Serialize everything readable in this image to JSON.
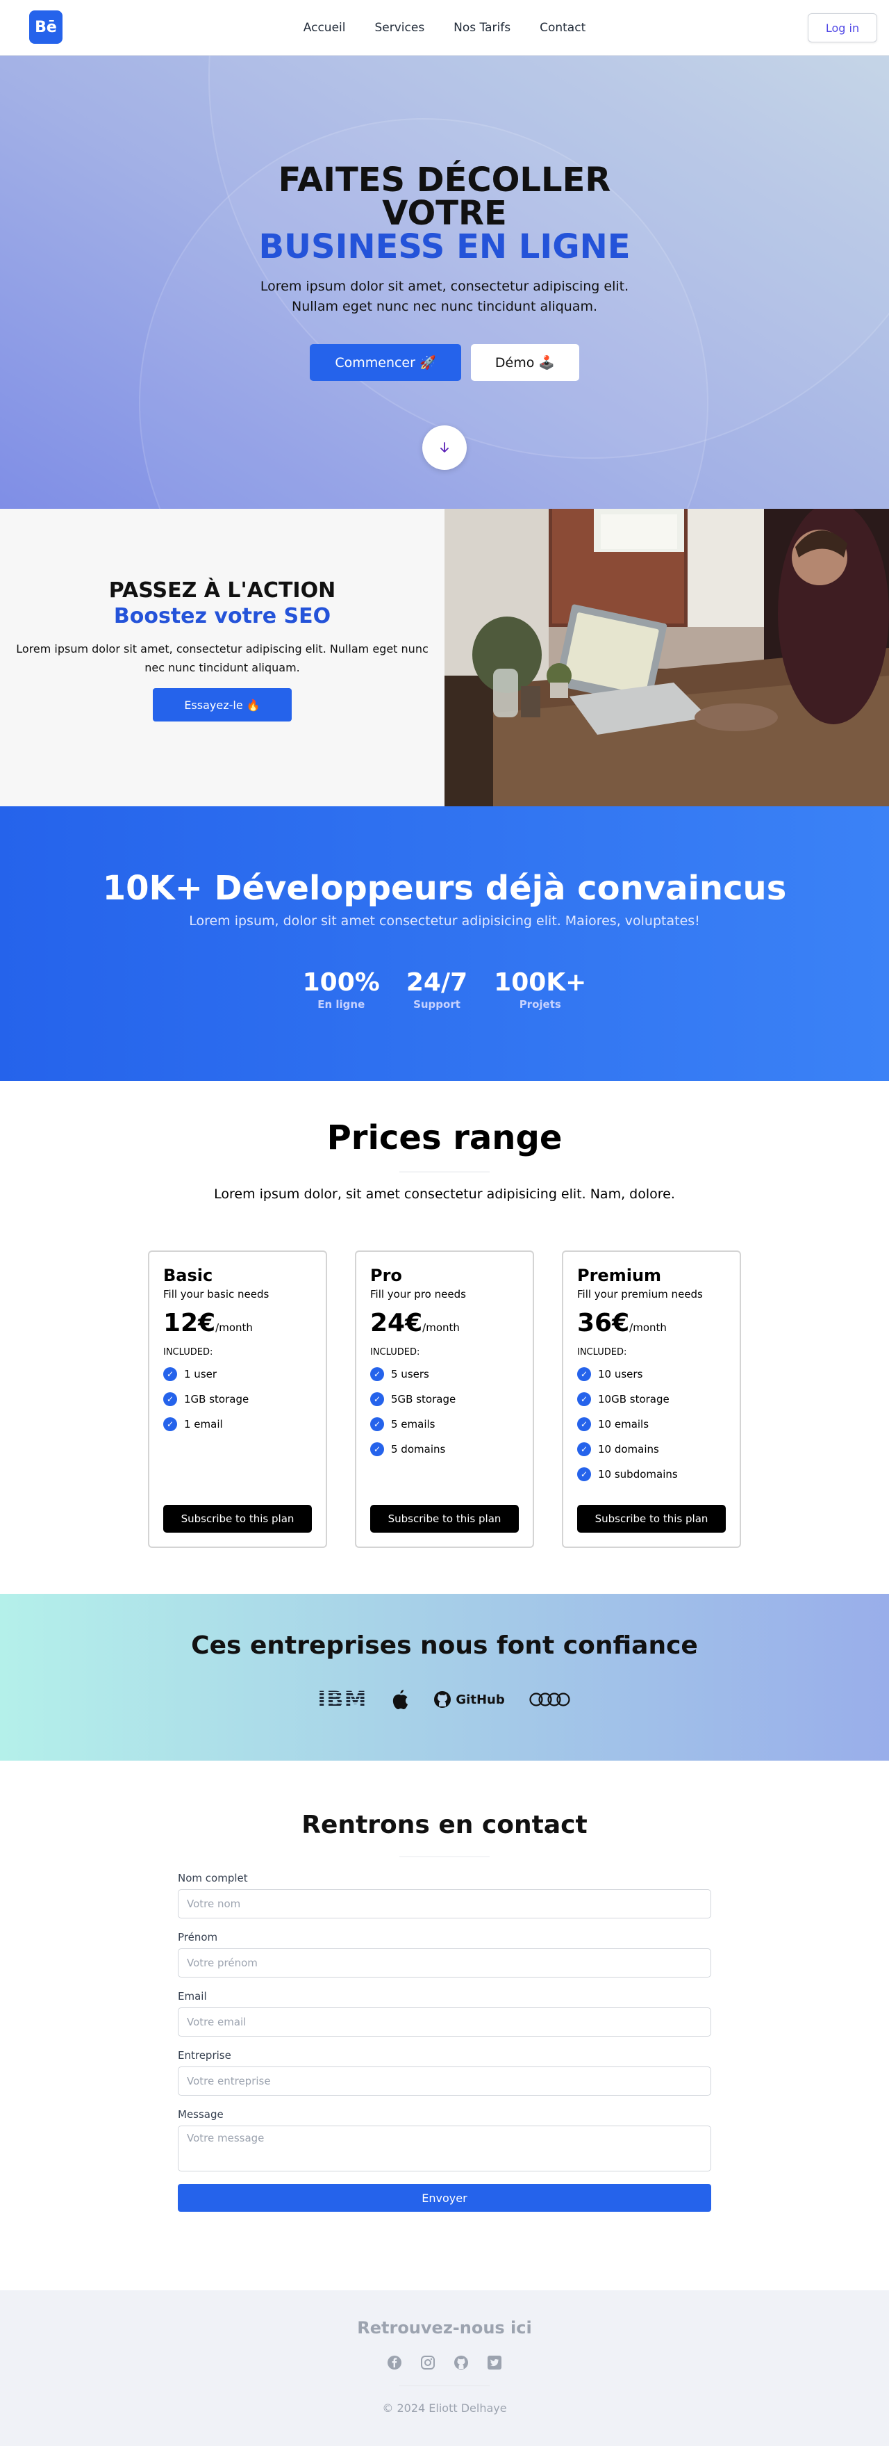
{
  "nav": {
    "logo_text": "Bē",
    "links": [
      "Accueil",
      "Services",
      "Nos Tarifs",
      "Contact"
    ],
    "login_label": "Log in"
  },
  "hero": {
    "title_line1": "FAITES DÉCOLLER",
    "title_line2": "VOTRE",
    "title_line3": "BUSINESS EN LIGNE",
    "subtitle": "Lorem ipsum dolor sit amet, consectetur adipiscing elit. Nullam eget nunc nec nunc tincidunt aliquam.",
    "primary_button": "Commencer 🚀",
    "secondary_button": "Démo 🕹️",
    "scroll_icon": "arrow-down-icon"
  },
  "seo": {
    "title": "PASSEZ À L'ACTION",
    "title_highlight": "Boostez votre SEO",
    "text": "Lorem ipsum dolor sit amet, consectetur adipiscing elit. Nullam eget nunc nec nunc tincidunt aliquam.",
    "button": "Essayez-le 🔥"
  },
  "stats": {
    "title": "10K+ Développeurs déjà convaincus",
    "subtitle": "Lorem ipsum, dolor sit amet consectetur adipisicing elit. Maiores, voluptates!",
    "items": [
      {
        "value": "100%",
        "label": "En ligne"
      },
      {
        "value": "24/7",
        "label": "Support"
      },
      {
        "value": "100K+",
        "label": "Projets"
      }
    ]
  },
  "pricing": {
    "title": "Prices range",
    "subtitle": "Lorem ipsum dolor, sit amet consectetur adipisicing elit. Nam, dolore.",
    "plans": [
      {
        "name": "Basic",
        "desc": "Fill your basic needs",
        "price": "12€",
        "period": "/month",
        "included": "INCLUDED:",
        "features": [
          "1 user",
          "1GB storage",
          "1 email"
        ],
        "button": "Subscribe to this plan"
      },
      {
        "name": "Pro",
        "desc": "Fill your pro needs",
        "price": "24€",
        "period": "/month",
        "included": "INCLUDED:",
        "features": [
          "5 users",
          "5GB storage",
          "5 emails",
          "5 domains"
        ],
        "button": "Subscribe to this plan"
      },
      {
        "name": "Premium",
        "desc": "Fill your premium needs",
        "price": "36€",
        "period": "/month",
        "included": "INCLUDED:",
        "features": [
          "10 users",
          "10GB storage",
          "10 emails",
          "10 domains",
          "10 subdomains"
        ],
        "button": "Subscribe to this plan"
      }
    ]
  },
  "trust": {
    "title": "Ces entreprises nous font confiance",
    "logos": [
      "IBM",
      "apple-logo-icon",
      "GitHub",
      "audi-logo-icon"
    ]
  },
  "contact": {
    "title": "Rentrons en contact",
    "fields": [
      {
        "label": "Nom complet",
        "placeholder": "Votre nom"
      },
      {
        "label": "Prénom",
        "placeholder": "Votre prénom"
      },
      {
        "label": "Email",
        "placeholder": "Votre email"
      },
      {
        "label": "Entreprise",
        "placeholder": "Votre entreprise"
      }
    ],
    "message_label": "Message",
    "message_placeholder": "Votre message",
    "submit": "Envoyer"
  },
  "footer": {
    "title": "Retrouvez-nous ici",
    "socials": [
      "facebook-icon",
      "instagram-icon",
      "github-icon",
      "twitter-icon"
    ],
    "copyright": "© 2024 Eliott Delhaye"
  }
}
